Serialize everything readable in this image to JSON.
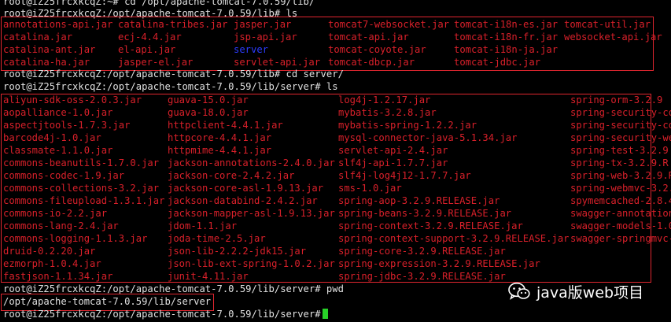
{
  "terminal": {
    "cmd0": "root@iZ25frcxkcqZ:~# cd /opt/apache-tomcat-7.0.59/lib/",
    "cmd1": "root@iZ25frcxkcqZ:/opt/apache-tomcat-7.0.59/lib# ls",
    "cmd2": "root@iZ25frcxkcqZ:/opt/apache-tomcat-7.0.59/lib# cd server/",
    "cmd3": "root@iZ25frcxkcqZ:/opt/apache-tomcat-7.0.59/lib/server# ls",
    "cmd4": "root@iZ25frcxkcqZ:/opt/apache-tomcat-7.0.59/lib/server# pwd",
    "pwd_output": "/opt/apache-tomcat-7.0.59/lib/server",
    "cmd5": "root@iZ25frcxkcqZ:/opt/apache-tomcat-7.0.59/lib/server#"
  },
  "lib_listing": [
    [
      "annotations-api.jar",
      "catalina.jar",
      "catalina-ant.jar",
      "catalina-ha.jar"
    ],
    [
      "catalina-tribes.jar",
      "ecj-4.4.jar",
      "el-api.jar",
      "jasper-el.jar"
    ],
    [
      "jasper.jar",
      "jsp-api.jar",
      "server",
      "servlet-api.jar"
    ],
    [
      "tomcat7-websocket.jar",
      "tomcat-api.jar",
      "tomcat-coyote.jar",
      "tomcat-dbcp.jar"
    ],
    [
      "tomcat-i18n-es.jar",
      "tomcat-i18n-fr.jar",
      "tomcat-i18n-ja.jar",
      "tomcat-jdbc.jar"
    ],
    [
      "tomcat-util.jar",
      "websocket-api.jar"
    ]
  ],
  "server_listing": [
    [
      "aliyun-sdk-oss-2.0.3.jar",
      "aopalliance-1.0.jar",
      "aspectjtools-1.7.3.jar",
      "barcode4j-1.0.jar",
      "classmate-1.1.0.jar",
      "commons-beanutils-1.7.0.jar",
      "commons-codec-1.9.jar",
      "commons-collections-3.2.jar",
      "commons-fileupload-1.3.1.jar",
      "commons-io-2.2.jar",
      "commons-lang-2.4.jar",
      "commons-logging-1.1.3.jar",
      "druid-0.2.20.jar",
      "ezmorph-1.0.4.jar",
      "fastjson-1.1.34.jar"
    ],
    [
      "guava-15.0.jar",
      "guava-18.0.jar",
      "httpclient-4.4.1.jar",
      "httpcore-4.4.1.jar",
      "httpmime-4.4.1.jar",
      "jackson-annotations-2.4.0.jar",
      "jackson-core-2.4.2.jar",
      "jackson-core-asl-1.9.13.jar",
      "jackson-databind-2.4.2.jar",
      "jackson-mapper-asl-1.9.13.jar",
      "jdom-1.1.jar",
      "joda-time-2.5.jar",
      "json-lib-2.2.2-jdk15.jar",
      "json-lib-ext-spring-1.0.2.jar",
      "junit-4.11.jar"
    ],
    [
      "log4j-1.2.17.jar",
      "mybatis-3.2.8.jar",
      "mybatis-spring-1.2.2.jar",
      "mysql-connector-java-5.1.34.jar",
      "servlet-api-2.4.jar",
      "slf4j-api-1.7.7.jar",
      "slf4j-log4j12-1.7.7.jar",
      "sms-1.0.jar",
      "spring-aop-3.2.9.RELEASE.jar",
      "spring-beans-3.2.9.RELEASE.jar",
      "spring-context-3.2.9.RELEASE.jar",
      "spring-context-support-3.2.9.RELEASE.jar",
      "spring-core-3.2.9.RELEASE.jar",
      "spring-expression-3.2.9.RELEASE.jar",
      "spring-jdbc-3.2.9.RELEASE.jar"
    ],
    [
      "spring-orm-3.2.9",
      "spring-security-co",
      "spring-security-co",
      "spring-security-we",
      "spring-test-3.2.9",
      "spring-tx-3.2.9.R",
      "spring-web-3.2.9.R",
      "spring-webmvc-3.2.",
      "spymemcached-2.8.4",
      "swagger-annotation",
      "swagger-models-1.0",
      "swagger-springmvc-"
    ]
  ],
  "watermark": {
    "text": "java版web项目",
    "icon": "wechat-icon"
  },
  "colors": {
    "background": "#000000",
    "prompt_text": "#e0e0e0",
    "file_text": "#d8202a",
    "directory_text": "#2c3cff",
    "highlight_box": "#e0262f",
    "cursor": "#28d228"
  }
}
